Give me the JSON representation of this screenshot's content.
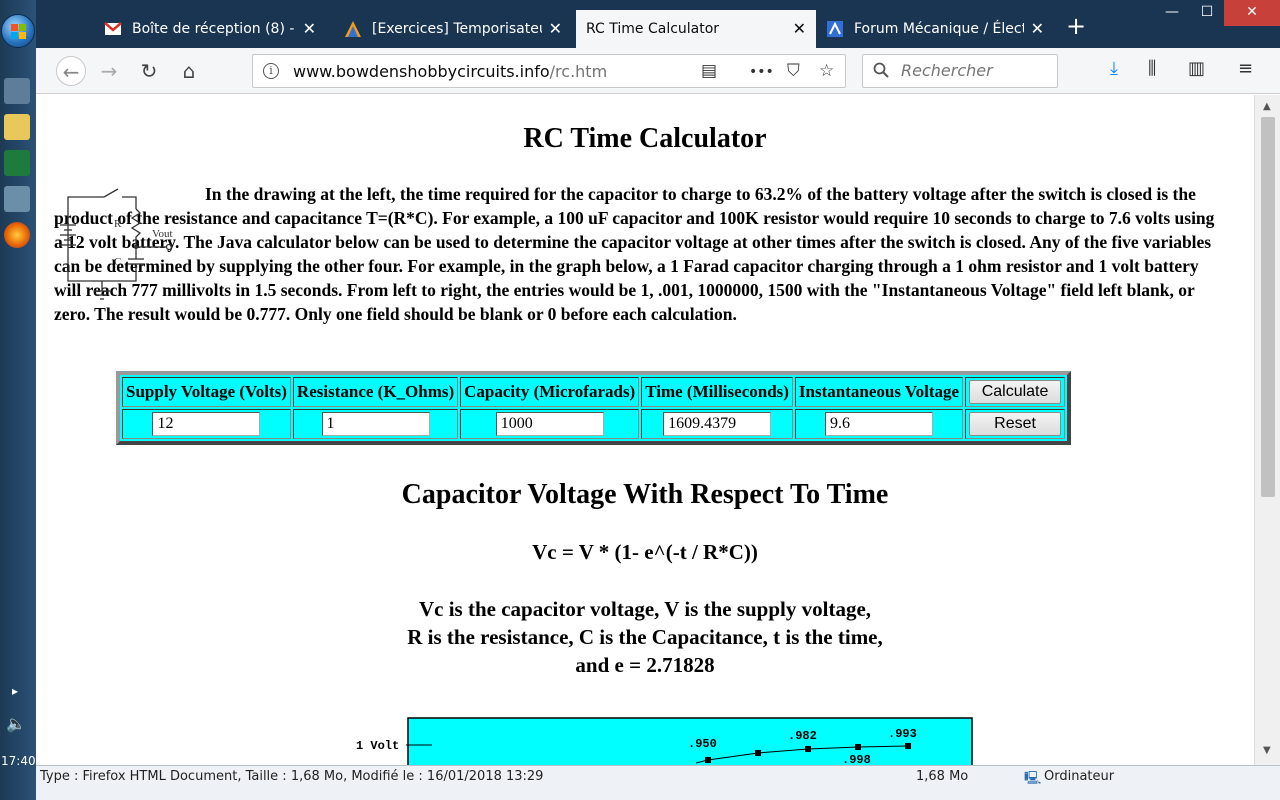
{
  "taskbar": {
    "clock": "17:40"
  },
  "tabs": [
    {
      "title": "Boîte de réception (8) - ",
      "active": false
    },
    {
      "title": "[Exercices] Temporisateur",
      "active": false
    },
    {
      "title": "RC Time Calculator",
      "active": true
    },
    {
      "title": "Forum Mécanique / Électr",
      "active": false
    }
  ],
  "window": {
    "minimize": "—",
    "maximize": "☐",
    "close": "✕"
  },
  "nav": {
    "url_host": "www.bowdenshobbycircuits.info",
    "url_path": "/rc.htm",
    "search_placeholder": "Rechercher",
    "more": "•••"
  },
  "page": {
    "title": "RC Time Calculator",
    "intro": "In the drawing at the left, the time required for the capacitor to charge to 63.2% of the battery voltage after the switch is closed is the product of the resistance and capacitance T=(R*C). For example, a 100 uF capacitor and 100K resistor would require 10 seconds to charge to 7.6 volts using a 12 volt battery. The Java calculator below can be used to determine the capacitor voltage at other times after the switch is closed. Any of the five variables can be determined by supplying the other four. For example, in the graph below, a 1 Farad capacitor charging through a 1 ohm resistor and 1 volt battery will reach 777 millivolts in 1.5 seconds. From left to right, the entries would be 1, .001, 1000000, 1500 with the \"Instantaneous Voltage\" field left blank, or zero. The result would be 0.777. Only one field should be blank or 0 before each calculation.",
    "circuit": {
      "r_label": "R",
      "c_label": "C",
      "vout_label": "Vout"
    },
    "calc": {
      "headers": [
        "Supply Voltage (Volts)",
        "Resistance (K_Ohms)",
        "Capacity (Microfarads)",
        "Time (Milliseconds)",
        "Instantaneous Voltage"
      ],
      "values": [
        "12",
        "1",
        "1000",
        "1609.4379",
        "9.6"
      ],
      "calculate": "Calculate",
      "reset": "Reset"
    },
    "subtitle": "Capacitor Voltage With Respect To Time",
    "formula": "Vc = V * (1- e^(-t / R*C))",
    "explain": [
      "Vc is the capacitor voltage, V is the supply voltage,",
      "R is the resistance, C is the Capacitance, t is the time,",
      "and e = 2.71828"
    ],
    "graph": {
      "ylabel": "1 Volt",
      "labels": [
        ".950",
        ".982",
        ".993",
        ".998"
      ],
      "bg": "#00ffff"
    }
  },
  "status": {
    "info": "Type : Firefox HTML Document, Taille : 1,68 Mo, Modifié le : 16/01/2018 13:29",
    "size": "1,68 Mo",
    "location": "Ordinateur"
  }
}
